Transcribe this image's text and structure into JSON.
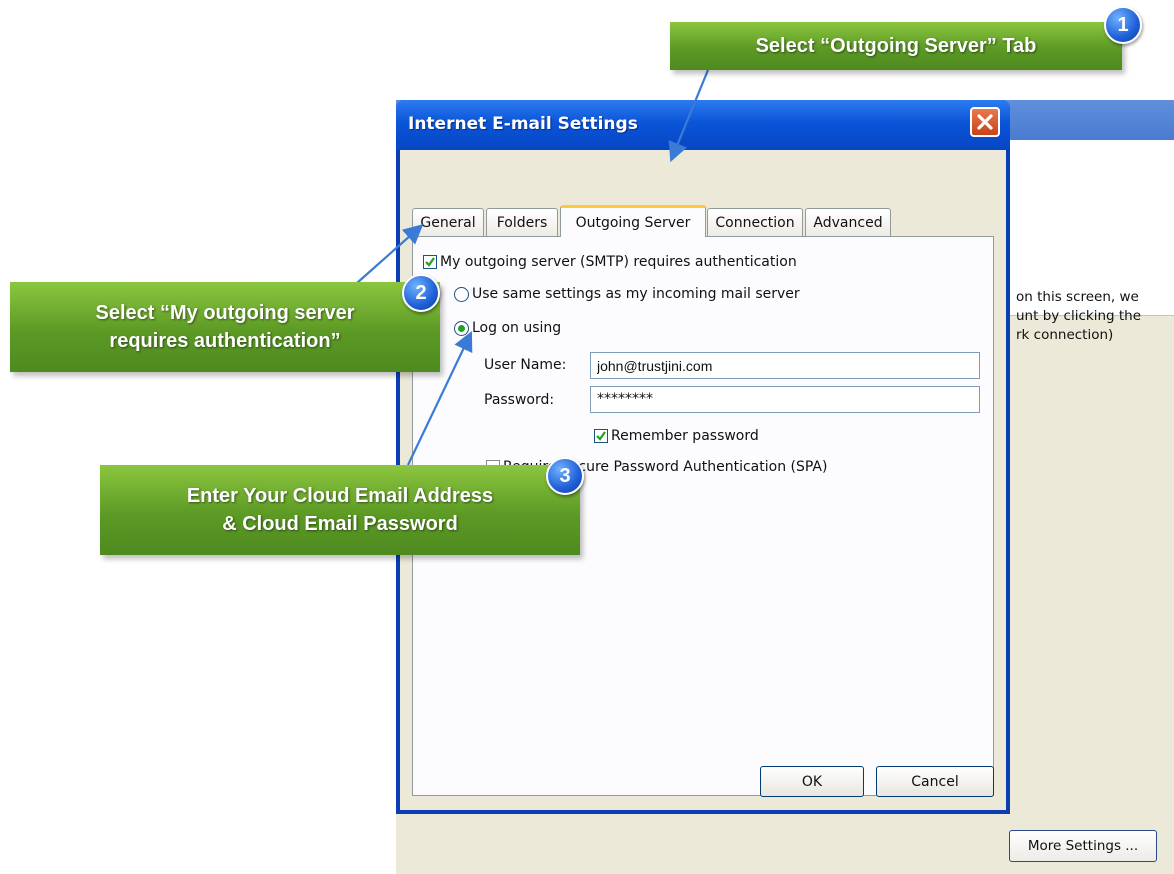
{
  "background_window": {
    "text_lines": [
      "on this screen, we",
      "unt by clicking the",
      "rk connection)"
    ],
    "more_settings_label": "More Settings ..."
  },
  "dialog": {
    "title": "Internet E-mail Settings",
    "tabs": [
      "General",
      "Folders",
      "Outgoing Server",
      "Connection",
      "Advanced"
    ],
    "active_tab": "Outgoing Server",
    "smtp_auth_label": "My outgoing server (SMTP) requires authentication",
    "smtp_auth_checked": true,
    "use_same_label": "Use same settings as my incoming mail server",
    "log_on_label": "Log on using",
    "selected_option": "Log on using",
    "username_label": "User Name:",
    "username_value": "john@trustjini.com",
    "password_label": "Password:",
    "password_value": "********",
    "remember_label": "Remember password",
    "remember_checked": true,
    "spa_label": "Require Secure Password Authentication (SPA)",
    "spa_checked": false,
    "ok_label": "OK",
    "cancel_label": "Cancel"
  },
  "callouts": [
    {
      "number": "1",
      "lines": [
        "Select “Outgoing Server” Tab"
      ]
    },
    {
      "number": "2",
      "lines": [
        "Select “My outgoing server",
        "requires authentication”"
      ]
    },
    {
      "number": "3",
      "lines": [
        "Enter Your Cloud Email Address",
        "& Cloud Email Password"
      ]
    }
  ],
  "colors": {
    "callout_green": "#6aa82e",
    "badge_blue": "#1f5fd6",
    "title_blue": "#0a55d8",
    "dialog_face": "#ECE9D8",
    "check_green": "#21a121"
  }
}
